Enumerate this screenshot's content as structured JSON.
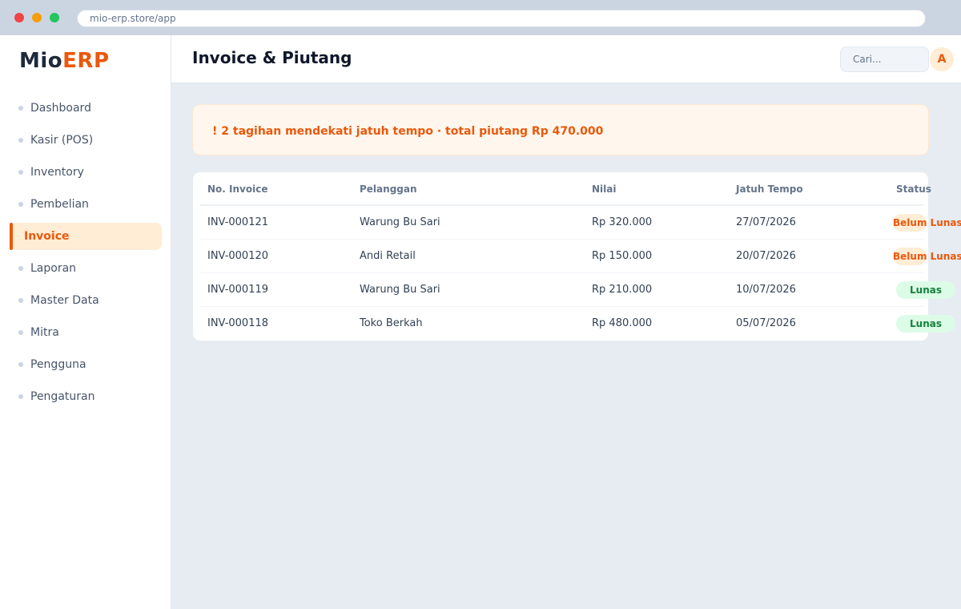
{
  "browser": {
    "url": "mio-erp.store/app"
  },
  "brand": {
    "name_primary": "Mio",
    "name_accent": "ERP",
    "accent_color": "#ea580c"
  },
  "sidebar": {
    "items": [
      {
        "label": "Dashboard",
        "active": false
      },
      {
        "label": "Kasir (POS)",
        "active": false
      },
      {
        "label": "Inventory",
        "active": false
      },
      {
        "label": "Pembelian",
        "active": false
      },
      {
        "label": "Invoice",
        "active": true
      },
      {
        "label": "Laporan",
        "active": false
      },
      {
        "label": "Master Data",
        "active": false
      },
      {
        "label": "Mitra",
        "active": false
      },
      {
        "label": "Pengguna",
        "active": false
      },
      {
        "label": "Pengaturan",
        "active": false
      }
    ]
  },
  "header": {
    "title": "Invoice & Piutang",
    "search_placeholder": "Cari...",
    "avatar_initial": "A"
  },
  "alert": {
    "text": "! 2 tagihan mendekati jatuh tempo · total piutang Rp 470.000"
  },
  "table": {
    "columns": [
      "No. Invoice",
      "Pelanggan",
      "Nilai",
      "Jatuh Tempo",
      "Status"
    ],
    "rows": [
      {
        "invoice": "INV-000121",
        "customer": "Warung Bu Sari",
        "amount": "Rp 320.000",
        "due": "27/07/2026",
        "status": "Belum Lunas",
        "status_type": "unpaid"
      },
      {
        "invoice": "INV-000120",
        "customer": "Andi Retail",
        "amount": "Rp 150.000",
        "due": "20/07/2026",
        "status": "Belum Lunas",
        "status_type": "unpaid"
      },
      {
        "invoice": "INV-000119",
        "customer": "Warung Bu Sari",
        "amount": "Rp 210.000",
        "due": "10/07/2026",
        "status": "Lunas",
        "status_type": "paid"
      },
      {
        "invoice": "INV-000118",
        "customer": "Toko Berkah",
        "amount": "Rp 480.000",
        "due": "05/07/2026",
        "status": "Lunas",
        "status_type": "paid"
      }
    ]
  },
  "colors": {
    "unpaid_badge_bg": "#ffedd5",
    "unpaid_badge_text": "#ea580c",
    "paid_badge_bg": "#dcfce7",
    "paid_badge_text": "#15803d"
  }
}
